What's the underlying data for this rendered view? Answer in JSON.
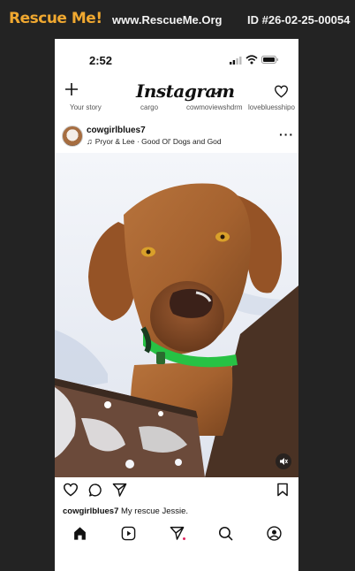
{
  "site_header": {
    "brand": "Rescue Me!",
    "site": "www.RescueMe.Org",
    "id_text": "ID #26-02-25-00054"
  },
  "status_bar": {
    "time": "2:52"
  },
  "app": {
    "logo_text": "Instagram",
    "icons": {
      "new_post": "plus-icon",
      "feed_menu": "chevron-down-icon",
      "activity": "heart-icon"
    }
  },
  "stories": [
    "Your story",
    "cargo",
    "cowmoviewshdrm",
    "lovebluesshipo"
  ],
  "post": {
    "username": "cowgirlblues7",
    "audio": "Pryor & Lee · Good Ol' Dogs and God",
    "more": "···",
    "caption_user": "cowgirlblues7",
    "caption_text": "My rescue Jessie.",
    "icons": [
      "heart-icon",
      "comment-icon",
      "share-icon",
      "bookmark-icon",
      "mute-icon"
    ]
  },
  "bottom_nav": [
    "home-icon",
    "reels-icon",
    "direct-icon",
    "search-icon",
    "profile-icon"
  ],
  "colors": {
    "brand": "#f0a830",
    "background": "#232323",
    "notification": "#e0245e"
  }
}
